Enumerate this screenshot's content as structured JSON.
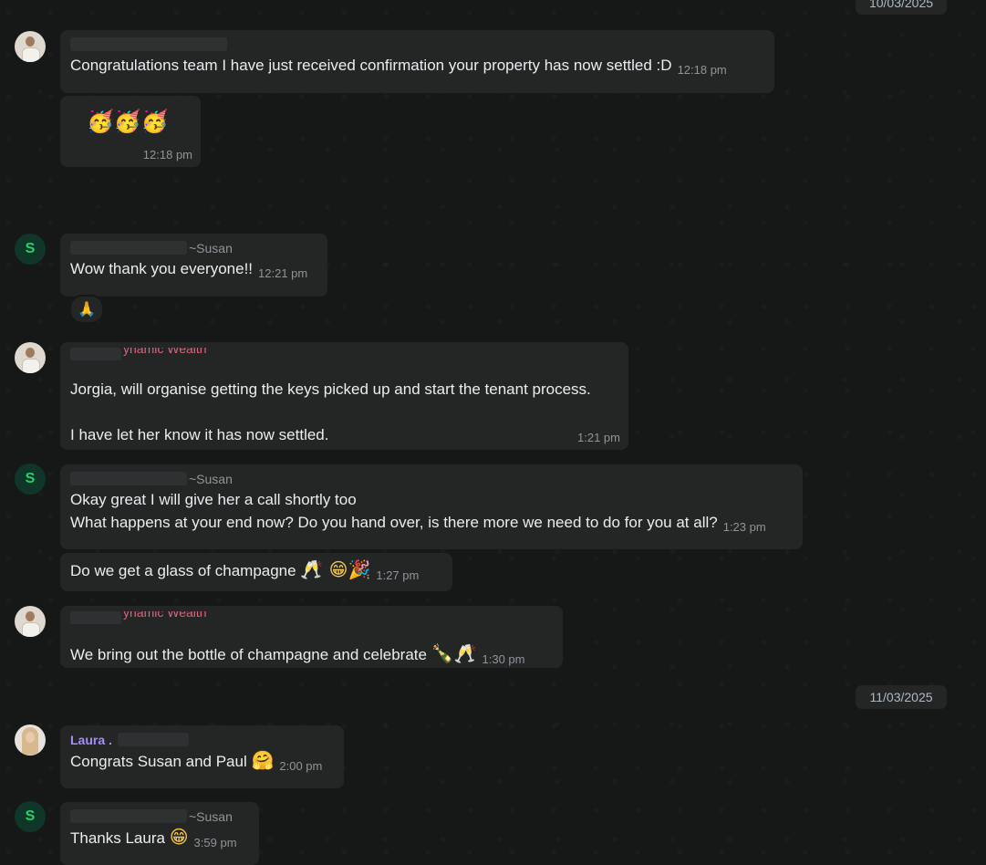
{
  "dates": {
    "top": "10/03/2025",
    "mid": "11/03/2025"
  },
  "messages": [
    {
      "id": "m1",
      "text": "Congratulations team I have just received confirmation your property has now settled :D",
      "time": "12:18 pm"
    },
    {
      "id": "m2",
      "emojis": "🥳🥳🥳",
      "time": "12:18 pm"
    },
    {
      "id": "m3",
      "sender": "~Susan",
      "avatar_letter": "S",
      "text": "Wow thank you everyone!!",
      "time": "12:21 pm",
      "reaction": "🙏"
    },
    {
      "id": "m4",
      "sender_fragment": "ynamic Wealth",
      "line1": "Jorgia, will organise getting the keys picked up and start the tenant process.",
      "line2": "I have let her know it has now settled.",
      "time": "1:21 pm"
    },
    {
      "id": "m5",
      "sender": "~Susan",
      "avatar_letter": "S",
      "line1": "Okay great I will give her a call shortly too",
      "line2": "What happens at your end now? Do you hand over, is there more we need to do for you at all?",
      "time": "1:23 pm"
    },
    {
      "id": "m6",
      "text": "Do we get a glass of champagne",
      "emojis": "🥂 😁🎉",
      "time": "1:27 pm"
    },
    {
      "id": "m7",
      "sender_fragment": "ynamic Wealth",
      "text": "We bring out the bottle of champagne and celebrate",
      "emojis": "🍾🥂",
      "time": "1:30 pm"
    },
    {
      "id": "m8",
      "sender": "Laura .",
      "text": "Congrats Susan and Paul",
      "emojis": "🤗",
      "time": "2:00 pm"
    },
    {
      "id": "m9",
      "sender": "~Susan",
      "avatar_letter": "S",
      "text": "Thanks Laura",
      "emojis": "😁",
      "time": "3:59 pm"
    }
  ]
}
